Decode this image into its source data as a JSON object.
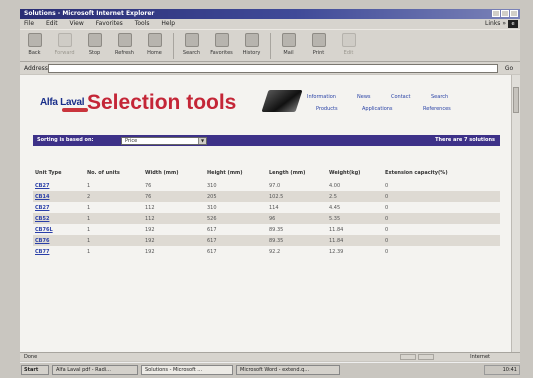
{
  "window": {
    "title": "Solutions - Microsoft Internet Explorer"
  },
  "menu": {
    "items": [
      "File",
      "Edit",
      "View",
      "Favorites",
      "Tools",
      "Help"
    ],
    "links_label": "Links »",
    "logo_text": "e"
  },
  "toolbar": {
    "buttons": [
      {
        "label": "Back",
        "icon": "back-arrow-icon",
        "enabled": true
      },
      {
        "label": "Forward",
        "icon": "forward-arrow-icon",
        "enabled": false
      },
      {
        "label": "Stop",
        "icon": "stop-icon",
        "enabled": true
      },
      {
        "label": "Refresh",
        "icon": "refresh-icon",
        "enabled": true
      },
      {
        "label": "Home",
        "icon": "home-icon",
        "enabled": true
      },
      {
        "label": "Search",
        "icon": "search-icon",
        "enabled": true
      },
      {
        "label": "Favorites",
        "icon": "favorites-icon",
        "enabled": true
      },
      {
        "label": "History",
        "icon": "history-icon",
        "enabled": true
      },
      {
        "label": "Mail",
        "icon": "mail-icon",
        "enabled": true
      },
      {
        "label": "Print",
        "icon": "print-icon",
        "enabled": true
      },
      {
        "label": "Edit",
        "icon": "edit-icon",
        "enabled": false
      }
    ]
  },
  "address": {
    "label": "Address",
    "value": "",
    "go_label": "Go"
  },
  "page": {
    "brand": "Alfa Laval",
    "title": "Selection tools",
    "nav_links": {
      "information": "Information",
      "news": "News",
      "contact": "Contact",
      "search": "Search",
      "products": "Products",
      "applications": "Applications",
      "references": "References"
    },
    "sort_label": "Sorting is based on:",
    "sort_value": "Price",
    "solutions_count": "There are 7 solutions",
    "table": {
      "headers": [
        "Unit Type",
        "No. of units",
        "Width (mm)",
        "Height (mm)",
        "Length (mm)",
        "Weight(kg)",
        "Extension capacity(%)"
      ],
      "rows": [
        [
          "CB27",
          "1",
          "76",
          "310",
          "97.0",
          "4.00",
          "0"
        ],
        [
          "CB14",
          "2",
          "76",
          "205",
          "102.5",
          "2.5",
          "0"
        ],
        [
          "CB27",
          "1",
          "112",
          "310",
          "114",
          "4.45",
          "0"
        ],
        [
          "CB52",
          "1",
          "112",
          "526",
          "96",
          "5.35",
          "0"
        ],
        [
          "CB76L",
          "1",
          "192",
          "617",
          "89.35",
          "11.84",
          "0"
        ],
        [
          "CB76",
          "1",
          "192",
          "617",
          "89.35",
          "11.84",
          "0"
        ],
        [
          "CB77",
          "1",
          "192",
          "617",
          "92.2",
          "12.39",
          "0"
        ]
      ]
    }
  },
  "status": {
    "text": "Done",
    "zone": "Internet"
  },
  "taskbar": {
    "start_label": "Start",
    "tasks": [
      "Alfa Laval pdf - Radi...",
      "Solutions - Microsoft ...",
      "Microsoft Word - extend.q..."
    ],
    "clock": "10:41"
  },
  "colors": {
    "title_red": "#c42637",
    "sort_bar": "#3d3188",
    "link_blue": "#2a3fa8"
  }
}
